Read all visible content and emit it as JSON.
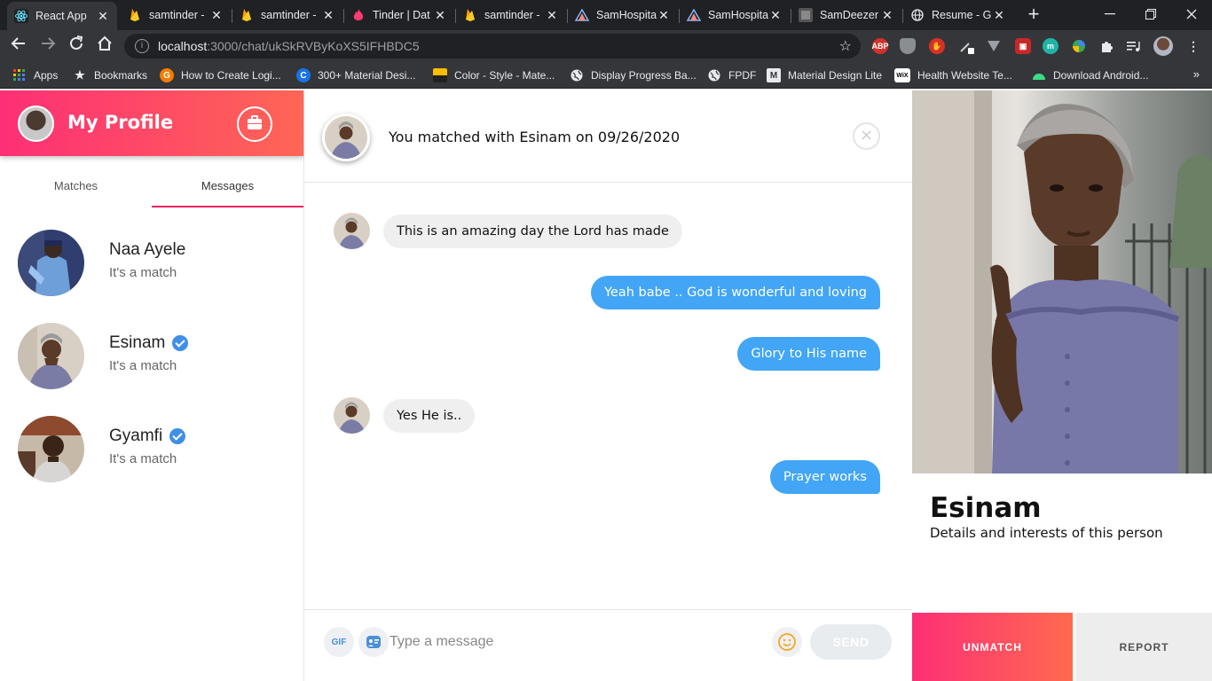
{
  "browser": {
    "tabs": [
      {
        "title": "React App",
        "icon": "react-icon",
        "active": true
      },
      {
        "title": "samtinder - ",
        "icon": "firebase-icon"
      },
      {
        "title": "samtinder - ",
        "icon": "firebase-icon"
      },
      {
        "title": "Tinder | Dat",
        "icon": "tinder-icon"
      },
      {
        "title": "samtinder - ",
        "icon": "firebase-icon"
      },
      {
        "title": "SamHospita",
        "icon": "triangle-icon"
      },
      {
        "title": "SamHospita",
        "icon": "triangle-icon"
      },
      {
        "title": "SamDeezer",
        "icon": "deezer-icon"
      },
      {
        "title": "Resume - G",
        "icon": "globe-icon"
      }
    ],
    "url_host": "localhost",
    "url_path": ":3000/chat/ukSkRVByKoXS5IFHBDC5",
    "extensions": [
      "ABP"
    ],
    "bookmarks": [
      {
        "label": "Apps",
        "icon": "apps-grid-icon"
      },
      {
        "label": "Bookmarks",
        "icon": "star-icon"
      },
      {
        "label": "How to Create Logi...",
        "icon": "site-icon"
      },
      {
        "label": "300+ Material Desi...",
        "icon": "c-icon"
      },
      {
        "label": "Color - Style - Mate...",
        "icon": "material-icon"
      },
      {
        "label": "Display Progress Ba...",
        "icon": "globe-icon"
      },
      {
        "label": "FPDF",
        "icon": "globe-icon"
      },
      {
        "label": "Material Design Lite",
        "icon": "m-icon"
      },
      {
        "label": "Health Website Te...",
        "icon": "wix-icon"
      },
      {
        "label": "Download Android...",
        "icon": "android-icon"
      }
    ],
    "bookmarks_more": "»"
  },
  "sidebar": {
    "title": "My Profile",
    "tabs": [
      "Matches",
      "Messages"
    ],
    "active_tab": "Messages",
    "matches": [
      {
        "name": "Naa Ayele",
        "status": "It's a match",
        "verified": false
      },
      {
        "name": "Esinam",
        "status": "It's a match",
        "verified": true
      },
      {
        "name": "Gyamfi",
        "status": "It's a match",
        "verified": true
      }
    ]
  },
  "chat": {
    "header": "You matched with Esinam on 09/26/2020",
    "close_symbol": "×",
    "messages": [
      {
        "from": "them",
        "text": "This is an amazing day the Lord has made"
      },
      {
        "from": "me",
        "text": "Yeah babe .. God is wonderful and loving"
      },
      {
        "from": "me",
        "text": "Glory to His name"
      },
      {
        "from": "them",
        "text": "Yes He is.."
      },
      {
        "from": "me",
        "text": "Prayer works"
      }
    ],
    "composer": {
      "gif_label": "GIF",
      "placeholder": "Type a message",
      "send_label": "SEND"
    }
  },
  "profile": {
    "name": "Esinam",
    "description": "Details and interests of this person",
    "unmatch_label": "UNMATCH",
    "report_label": "REPORT"
  },
  "colors": {
    "brand_gradient_start": "#fd2f76",
    "brand_gradient_end": "#ff6655",
    "outgoing_bubble": "#42a5f5",
    "incoming_bubble": "#efefef",
    "verified_badge": "#3f8fe8"
  }
}
